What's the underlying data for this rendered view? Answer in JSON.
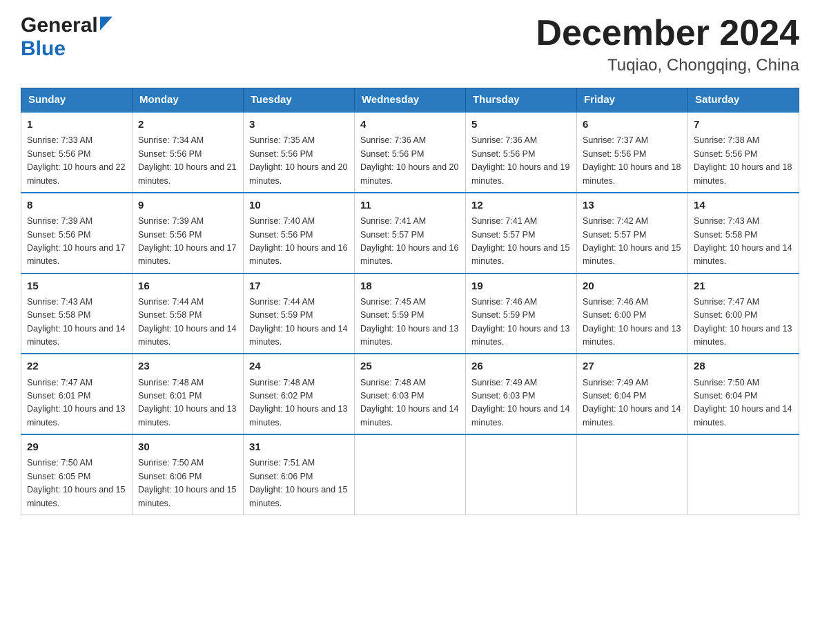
{
  "header": {
    "logo_general": "General",
    "logo_blue": "Blue",
    "month_title": "December 2024",
    "location": "Tuqiao, Chongqing, China"
  },
  "calendar": {
    "days_of_week": [
      "Sunday",
      "Monday",
      "Tuesday",
      "Wednesday",
      "Thursday",
      "Friday",
      "Saturday"
    ],
    "weeks": [
      [
        {
          "day": "1",
          "sunrise": "7:33 AM",
          "sunset": "5:56 PM",
          "daylight": "10 hours and 22 minutes."
        },
        {
          "day": "2",
          "sunrise": "7:34 AM",
          "sunset": "5:56 PM",
          "daylight": "10 hours and 21 minutes."
        },
        {
          "day": "3",
          "sunrise": "7:35 AM",
          "sunset": "5:56 PM",
          "daylight": "10 hours and 20 minutes."
        },
        {
          "day": "4",
          "sunrise": "7:36 AM",
          "sunset": "5:56 PM",
          "daylight": "10 hours and 20 minutes."
        },
        {
          "day": "5",
          "sunrise": "7:36 AM",
          "sunset": "5:56 PM",
          "daylight": "10 hours and 19 minutes."
        },
        {
          "day": "6",
          "sunrise": "7:37 AM",
          "sunset": "5:56 PM",
          "daylight": "10 hours and 18 minutes."
        },
        {
          "day": "7",
          "sunrise": "7:38 AM",
          "sunset": "5:56 PM",
          "daylight": "10 hours and 18 minutes."
        }
      ],
      [
        {
          "day": "8",
          "sunrise": "7:39 AM",
          "sunset": "5:56 PM",
          "daylight": "10 hours and 17 minutes."
        },
        {
          "day": "9",
          "sunrise": "7:39 AM",
          "sunset": "5:56 PM",
          "daylight": "10 hours and 17 minutes."
        },
        {
          "day": "10",
          "sunrise": "7:40 AM",
          "sunset": "5:56 PM",
          "daylight": "10 hours and 16 minutes."
        },
        {
          "day": "11",
          "sunrise": "7:41 AM",
          "sunset": "5:57 PM",
          "daylight": "10 hours and 16 minutes."
        },
        {
          "day": "12",
          "sunrise": "7:41 AM",
          "sunset": "5:57 PM",
          "daylight": "10 hours and 15 minutes."
        },
        {
          "day": "13",
          "sunrise": "7:42 AM",
          "sunset": "5:57 PM",
          "daylight": "10 hours and 15 minutes."
        },
        {
          "day": "14",
          "sunrise": "7:43 AM",
          "sunset": "5:58 PM",
          "daylight": "10 hours and 14 minutes."
        }
      ],
      [
        {
          "day": "15",
          "sunrise": "7:43 AM",
          "sunset": "5:58 PM",
          "daylight": "10 hours and 14 minutes."
        },
        {
          "day": "16",
          "sunrise": "7:44 AM",
          "sunset": "5:58 PM",
          "daylight": "10 hours and 14 minutes."
        },
        {
          "day": "17",
          "sunrise": "7:44 AM",
          "sunset": "5:59 PM",
          "daylight": "10 hours and 14 minutes."
        },
        {
          "day": "18",
          "sunrise": "7:45 AM",
          "sunset": "5:59 PM",
          "daylight": "10 hours and 13 minutes."
        },
        {
          "day": "19",
          "sunrise": "7:46 AM",
          "sunset": "5:59 PM",
          "daylight": "10 hours and 13 minutes."
        },
        {
          "day": "20",
          "sunrise": "7:46 AM",
          "sunset": "6:00 PM",
          "daylight": "10 hours and 13 minutes."
        },
        {
          "day": "21",
          "sunrise": "7:47 AM",
          "sunset": "6:00 PM",
          "daylight": "10 hours and 13 minutes."
        }
      ],
      [
        {
          "day": "22",
          "sunrise": "7:47 AM",
          "sunset": "6:01 PM",
          "daylight": "10 hours and 13 minutes."
        },
        {
          "day": "23",
          "sunrise": "7:48 AM",
          "sunset": "6:01 PM",
          "daylight": "10 hours and 13 minutes."
        },
        {
          "day": "24",
          "sunrise": "7:48 AM",
          "sunset": "6:02 PM",
          "daylight": "10 hours and 13 minutes."
        },
        {
          "day": "25",
          "sunrise": "7:48 AM",
          "sunset": "6:03 PM",
          "daylight": "10 hours and 14 minutes."
        },
        {
          "day": "26",
          "sunrise": "7:49 AM",
          "sunset": "6:03 PM",
          "daylight": "10 hours and 14 minutes."
        },
        {
          "day": "27",
          "sunrise": "7:49 AM",
          "sunset": "6:04 PM",
          "daylight": "10 hours and 14 minutes."
        },
        {
          "day": "28",
          "sunrise": "7:50 AM",
          "sunset": "6:04 PM",
          "daylight": "10 hours and 14 minutes."
        }
      ],
      [
        {
          "day": "29",
          "sunrise": "7:50 AM",
          "sunset": "6:05 PM",
          "daylight": "10 hours and 15 minutes."
        },
        {
          "day": "30",
          "sunrise": "7:50 AM",
          "sunset": "6:06 PM",
          "daylight": "10 hours and 15 minutes."
        },
        {
          "day": "31",
          "sunrise": "7:51 AM",
          "sunset": "6:06 PM",
          "daylight": "10 hours and 15 minutes."
        },
        null,
        null,
        null,
        null
      ]
    ],
    "sunrise_label": "Sunrise:",
    "sunset_label": "Sunset:",
    "daylight_label": "Daylight:"
  }
}
